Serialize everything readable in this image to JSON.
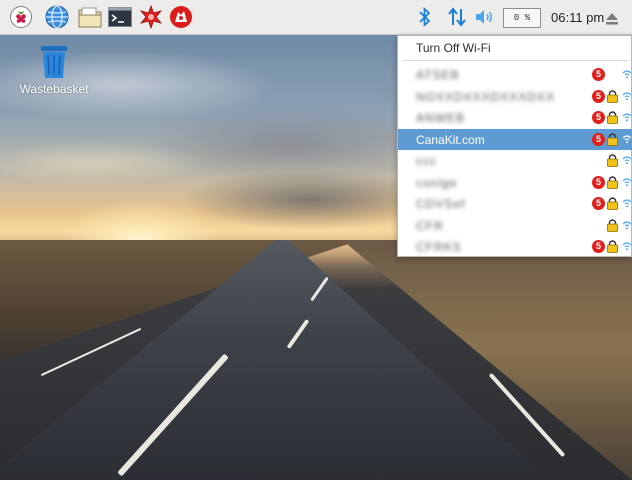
{
  "desktop": {
    "icons": [
      {
        "label": "Wastebasket",
        "icon": "wastebasket-icon"
      }
    ]
  },
  "taskbar": {
    "launchers": [
      {
        "name": "raspberry-menu-icon"
      },
      {
        "name": "web-browser-icon"
      },
      {
        "name": "file-manager-icon"
      },
      {
        "name": "terminal-icon"
      },
      {
        "name": "mathematica-icon"
      },
      {
        "name": "wolfram-icon"
      }
    ],
    "tray": {
      "cpu_usage": "0 %",
      "clock": "06:11 pm"
    }
  },
  "wifi_menu": {
    "toggle_label": "Turn Off Wi-Fi",
    "networks": [
      {
        "name": "ATSEB",
        "badge": "5",
        "locked": false,
        "selected": false
      },
      {
        "name": "NOXXDXXXDXXXDXX",
        "badge": "5",
        "locked": true,
        "selected": false
      },
      {
        "name": "ANWEB",
        "badge": "5",
        "locked": true,
        "selected": false
      },
      {
        "name": "CanaKit.com",
        "badge": "5",
        "locked": true,
        "selected": true
      },
      {
        "name": "ccc",
        "badge": "",
        "locked": true,
        "selected": false
      },
      {
        "name": "conlge",
        "badge": "5",
        "locked": true,
        "selected": false
      },
      {
        "name": "CDVSef",
        "badge": "5",
        "locked": true,
        "selected": false
      },
      {
        "name": "CFR",
        "badge": "",
        "locked": true,
        "selected": false
      },
      {
        "name": "CFRKS",
        "badge": "5",
        "locked": true,
        "selected": false
      }
    ]
  },
  "colors": {
    "selection": "#5e9bd2",
    "tray_blue": "#1a7fd6",
    "badge_red": "#e0201b"
  }
}
